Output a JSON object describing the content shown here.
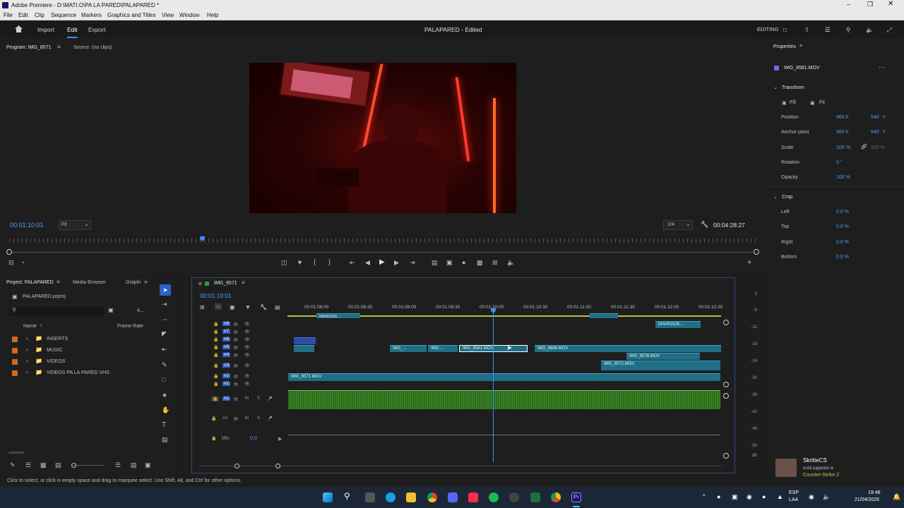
{
  "window": {
    "title": "Adobe Premiere - D:\\MATI.O\\PA LA PARED\\PALAPARED *"
  },
  "menu": [
    "File",
    "Edit",
    "Clip",
    "Sequence",
    "Markers",
    "Graphics and Titles",
    "View",
    "Window",
    "Help"
  ],
  "header": {
    "import": "Import",
    "edit": "Edit",
    "export": "Export",
    "project_title": "PALAPARED - Edited",
    "workspace": "EDITING"
  },
  "program": {
    "tab_program": "Program: IMG_8571",
    "tab_source": "Source: (no clips)",
    "timecode": "00:01:10:01",
    "zoom": "Fit",
    "resolution": "1/4",
    "duration": "00:04:28:27"
  },
  "properties": {
    "title": "Properties",
    "clip_name": "IMG_8581.MOV",
    "transform_label": "Transform",
    "fill": "Fill",
    "fit": "Fit",
    "position_label": "Position",
    "position_x": "960",
    "position_x_unit": "X",
    "position_y": "540",
    "position_y_unit": "Y",
    "anchor_label": "Anchor point",
    "anchor_x": "960",
    "anchor_x_unit": "X",
    "anchor_y": "540",
    "anchor_y_unit": "Y",
    "scale_label": "Scale",
    "scale_value": "100",
    "scale_unit": "%",
    "scale_value2": "100 %",
    "rotation_label": "Rotation",
    "rotation_value": "0 °",
    "opacity_label": "Opacity",
    "opacity_value": "100 %",
    "crop_label": "Crop",
    "left_label": "Left",
    "left_value": "0.0 %",
    "top_label": "Top",
    "top_value": "0.0 %",
    "right_label": "Right",
    "right_value": "0.0 %",
    "bottom_label": "Bottom",
    "bottom_value": "0.0 %"
  },
  "project": {
    "tab_project": "Project: PALAPARED",
    "tab_media": "Media Browser",
    "tab_graphics": "Graphi",
    "file": "PALAPARED.prproj",
    "count": "4...",
    "col_name": "Name",
    "col_framerate": "Frame Rate",
    "folders": [
      "INSERTS",
      "MUSIC",
      "VIDEOS",
      "VIDEOS PA LA PARED VHS"
    ]
  },
  "timeline": {
    "tab": "IMG_8571",
    "timecode": "00:01:10:01",
    "ruler": [
      "00:01:08:00",
      "00:01:08:30",
      "00:01:09:00",
      "00:01:09:30",
      "00:01:10:00",
      "00:01:10:30",
      "00:01:11:00",
      "00:01:11:30",
      "00:01:12:00",
      "00:01:12:30"
    ],
    "video_tracks": [
      "V8",
      "V7",
      "V6",
      "V5",
      "V4",
      "V3",
      "V2",
      "V1"
    ],
    "audio_tracks": [
      "A1",
      "A2"
    ],
    "mix_label": "Mix",
    "mix_value": "0.0",
    "clips": {
      "mah": "MAH01526...",
      "top_left": "MAH01526...",
      "img_a": "IMG_...",
      "img_b": "IMG...",
      "selected": "IMG_8581.MOV",
      "c8666": "IMG_8666.MOV",
      "c8578": "IMG_8578.MOV",
      "c8572": "IMG_8572.MOV",
      "c8571": "IMG_8571.MOV"
    }
  },
  "meter": [
    "0",
    "-6",
    "-12",
    "-18",
    "-24",
    "-30",
    "-36",
    "-42",
    "-48",
    "-54",
    "dB"
  ],
  "status_bar": "Click to select, or click in empty space and drag to marquee select. Use Shift, Alt, and Ctrl for other options.",
  "notification": {
    "name": "SkritteCS",
    "line1": "está jugando a",
    "line2": "Counter-Strike 2"
  },
  "taskbar": {
    "lang1": "ESP",
    "lang2": "LAA",
    "time": "19:48",
    "date": "21/04/2026"
  },
  "colors": {
    "accent": "#3b8cff",
    "clip": "#1f6f86",
    "audio": "#2f6b1e",
    "folder": "#d2691e"
  }
}
